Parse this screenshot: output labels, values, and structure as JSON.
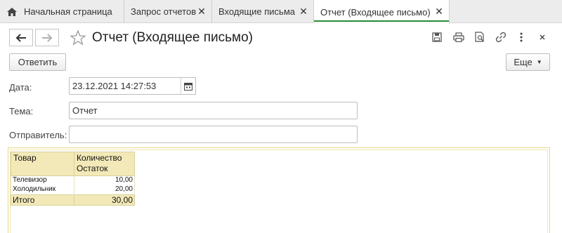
{
  "tabs": [
    {
      "label": "Начальная страница",
      "closable": false
    },
    {
      "label": "Запрос отчетов",
      "closable": true
    },
    {
      "label": "Входящие письма",
      "closable": true
    },
    {
      "label": "Отчет (Входящее письмо)",
      "closable": true,
      "active": true
    }
  ],
  "window": {
    "title": "Отчет (Входящее письмо)"
  },
  "toolbar": {
    "reply_label": "Ответить",
    "more_label": "Еще"
  },
  "form": {
    "date_label": "Дата:",
    "date_value": "23.12.2021 14:27:53",
    "subject_label": "Тема:",
    "subject_value": "Отчет",
    "sender_label": "Отправитель:",
    "sender_value": ""
  },
  "report": {
    "headers": [
      "Товар",
      "Количество\nОстаток"
    ],
    "rows": [
      {
        "item": "Телевизор",
        "qty": "10,00"
      },
      {
        "item": "Холодильник",
        "qty": "20,00"
      }
    ],
    "total_label": "Итого",
    "total_value": "30,00"
  },
  "colors": {
    "active_tab_accent": "#2a8a3a",
    "report_header_bg": "#f3e9b8",
    "report_border": "#e6d98a"
  }
}
